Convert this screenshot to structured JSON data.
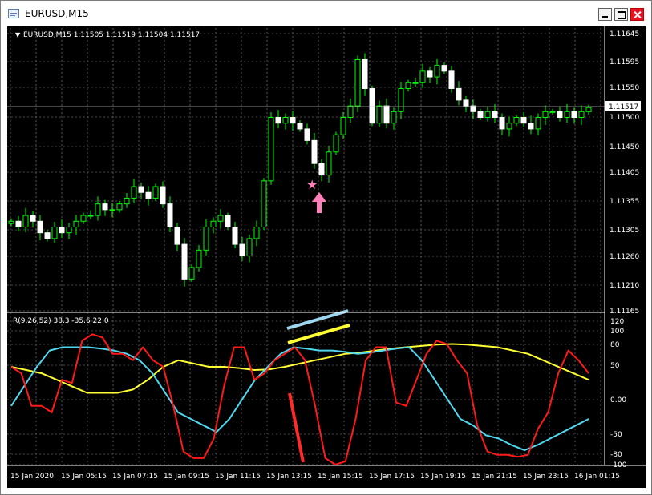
{
  "window": {
    "title": "EURUSD,M15"
  },
  "main_chart": {
    "header": "EURUSD,M15  1.11505 1.11519 1.11504 1.11517",
    "current_price": "1.11517",
    "price_labels": [
      "1.11645",
      "1.11595",
      "1.11550",
      "1.11500",
      "1.11450",
      "1.11405",
      "1.11355",
      "1.11305",
      "1.11260",
      "1.11210",
      "1.11165"
    ]
  },
  "indicator": {
    "header": "R(9,26,52) 38.3 -35.6 22.0",
    "labels": [
      "120",
      "100",
      "80",
      "50",
      "0.00",
      "-50",
      "-80",
      "-100"
    ]
  },
  "time_axis": {
    "labels": [
      "15 Jan 2020",
      "15 Jan 05:15",
      "15 Jan 07:15",
      "15 Jan 09:15",
      "15 Jan 11:15",
      "15 Jan 13:15",
      "15 Jan 15:15",
      "15 Jan 17:15",
      "15 Jan 19:15",
      "15 Jan 21:15",
      "15 Jan 23:15",
      "16 Jan 01:15"
    ]
  },
  "colors": {
    "background": "#000000",
    "grid": "#8c8c8c",
    "candle": "#00ff00",
    "red_line": "#ff1a1a",
    "cyan_line": "#4fd8f0",
    "yellow_line": "#ffff33",
    "star": "#ff7fb8"
  },
  "chart_data": {
    "type": "candlestick",
    "symbol": "EURUSD",
    "timeframe": "M15",
    "ylim": [
      1.11165,
      1.11645
    ],
    "closes": [
      1.1132,
      1.1131,
      1.1133,
      1.1132,
      1.113,
      1.1129,
      1.1131,
      1.113,
      1.1131,
      1.1132,
      1.1133,
      1.1133,
      1.1135,
      1.1134,
      1.1134,
      1.1135,
      1.1136,
      1.1138,
      1.1137,
      1.1136,
      1.1138,
      1.1135,
      1.1131,
      1.1128,
      1.1122,
      1.1124,
      1.1127,
      1.1131,
      1.1132,
      1.1133,
      1.1131,
      1.1128,
      1.1126,
      1.1129,
      1.1131,
      1.1139,
      1.115,
      1.1149,
      1.115,
      1.1149,
      1.1148,
      1.1146,
      1.1142,
      1.114,
      1.1144,
      1.1147,
      1.115,
      1.1152,
      1.116,
      1.1155,
      1.1149,
      1.1152,
      1.1149,
      1.1151,
      1.1155,
      1.1156,
      1.1156,
      1.1158,
      1.1157,
      1.1159,
      1.1158,
      1.1155,
      1.1153,
      1.1152,
      1.1151,
      1.115,
      1.1151,
      1.115,
      1.1148,
      1.1149,
      1.115,
      1.1149,
      1.1148,
      1.115,
      1.1151,
      1.1151,
      1.115,
      1.1151,
      1.115,
      1.1151,
      1.11517
    ],
    "annotations": [
      "pink star marker below a swing low",
      "pink up arrow below the star"
    ],
    "indicator": {
      "name": "R(9,26,52)",
      "ylim": [
        -100,
        120
      ],
      "series": [
        {
          "name": "red",
          "values": [
            50,
            40,
            -10,
            -10,
            -20,
            30,
            25,
            90,
            100,
            95,
            70,
            70,
            60,
            80,
            60,
            50,
            -10,
            -80,
            -90,
            -90,
            -60,
            20,
            80,
            80,
            30,
            40,
            60,
            70,
            80,
            60,
            -10,
            -90,
            -100,
            -95,
            -30,
            60,
            80,
            80,
            -5,
            -10,
            30,
            70,
            90,
            85,
            60,
            40,
            -40,
            -80,
            -85,
            -85,
            -88,
            -85,
            -45,
            -20,
            40,
            75,
            60,
            40
          ]
        },
        {
          "name": "cyan",
          "values": [
            -10,
            20,
            50,
            75,
            80,
            80,
            80,
            78,
            75,
            70,
            60,
            40,
            10,
            -20,
            -30,
            -40,
            -50,
            -30,
            0,
            30,
            50,
            70,
            80,
            78,
            75,
            75,
            73,
            70,
            72,
            75,
            78,
            80,
            60,
            30,
            0,
            -30,
            -40,
            -55,
            -60,
            -70,
            -78,
            -70,
            -60,
            -50,
            -40,
            -30
          ]
        },
        {
          "name": "yellow",
          "values": [
            50,
            45,
            40,
            30,
            20,
            10,
            10,
            10,
            15,
            30,
            50,
            60,
            55,
            50,
            50,
            48,
            45,
            46,
            50,
            55,
            60,
            65,
            70,
            72,
            75,
            78,
            80,
            82,
            84,
            85,
            84,
            82,
            80,
            75,
            70,
            60,
            50,
            40,
            30
          ]
        }
      ]
    }
  }
}
